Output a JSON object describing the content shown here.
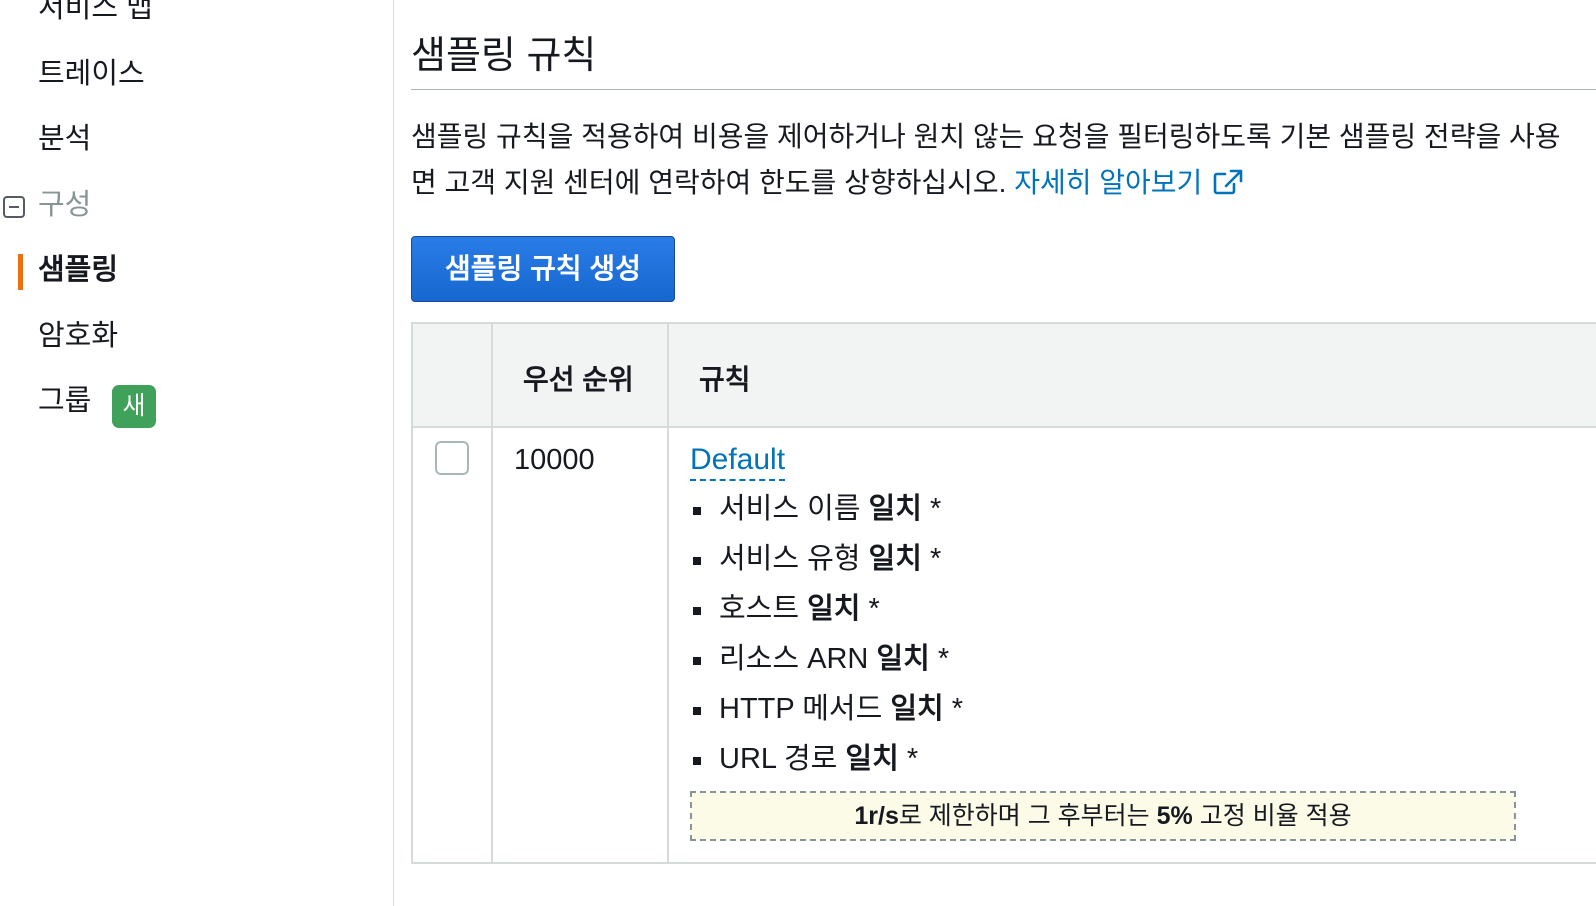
{
  "sidebar": {
    "items": [
      {
        "label": "서비스 맵"
      },
      {
        "label": "트레이스"
      },
      {
        "label": "분석"
      },
      {
        "label": "구성"
      },
      {
        "label": "샘플링"
      },
      {
        "label": "암호화"
      },
      {
        "label": "그룹"
      }
    ],
    "new_badge": "새",
    "active_item": "샘플링",
    "accent_color": "#ec7211"
  },
  "main": {
    "title": "샘플링 규칙",
    "description_line1": "샘플링 규칙을 적용하여 비용을 제어하거나 원치 않는 요청을 필터링하도록 기본 샘플링 전략을 사용",
    "description_line2": "면 고객 지원 센터에 연락하여 한도를 상향하십시오.",
    "learn_more_link": "자세히 알아보기",
    "create_button": "샘플링 규칙 생성",
    "table": {
      "headers": [
        "우선 순위",
        "규칙"
      ],
      "rows": [
        {
          "priority": "10000",
          "rule_name": "Default",
          "conditions": [
            {
              "label": "서비스 이름",
              "match": "일치",
              "value": "*"
            },
            {
              "label": "서비스 유형",
              "match": "일치",
              "value": "*"
            },
            {
              "label": "호스트",
              "match": "일치",
              "value": "*"
            },
            {
              "label": "리소스 ARN",
              "match": "일치",
              "value": "*"
            },
            {
              "label": "HTTP 메서드",
              "match": "일치",
              "value": "*"
            },
            {
              "label": "URL 경로",
              "match": "일치",
              "value": "*"
            }
          ],
          "rate_reservoir": "1r/s",
          "rate_text_1": "로 제한하며 그 후부터는",
          "rate_percent": "5%",
          "rate_text_2": "고정 비율 적용"
        }
      ]
    }
  },
  "colors": {
    "link": "#0073bb",
    "primary_button": "#1767d0",
    "badge_green": "#3fa15a",
    "note_background": "#fbfbe7"
  }
}
